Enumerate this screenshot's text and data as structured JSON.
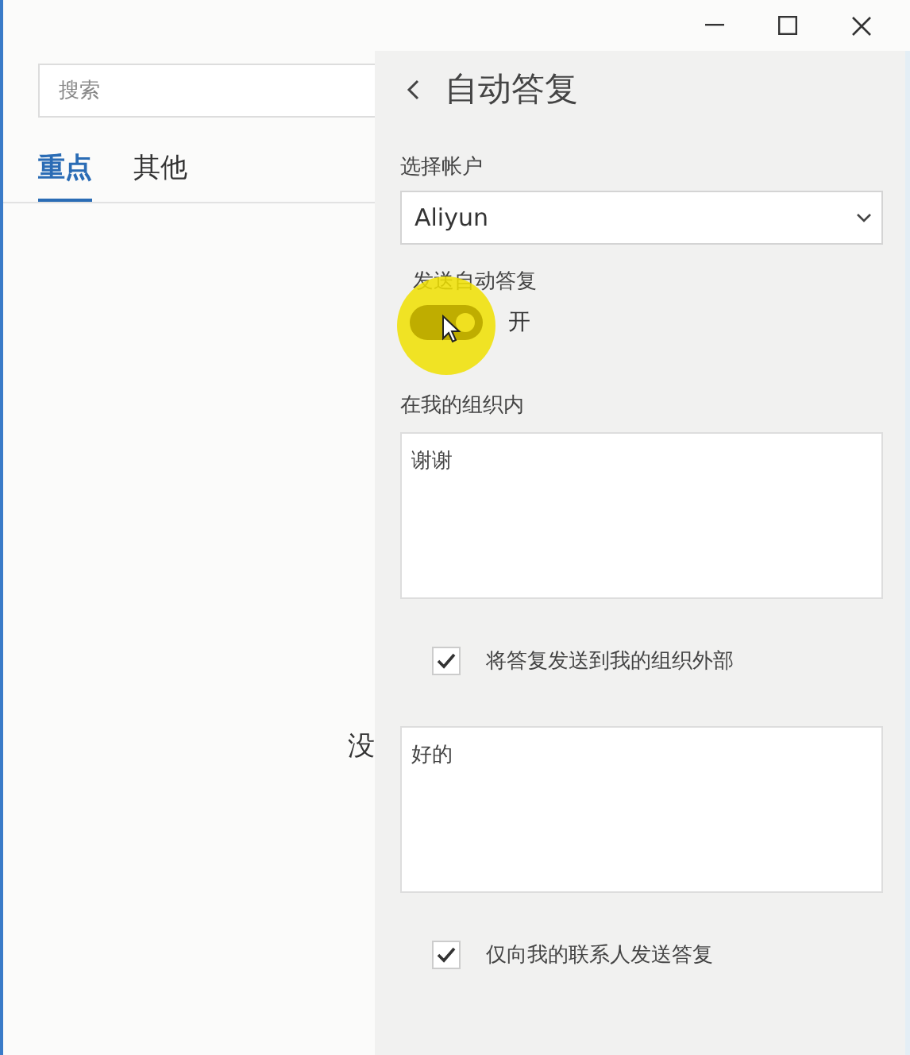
{
  "search": {
    "placeholder": "搜索"
  },
  "tabs": [
    {
      "label": "重点",
      "selected": true
    },
    {
      "label": "其他",
      "selected": false
    }
  ],
  "message_list": {
    "empty_text": "没"
  },
  "auto_reply": {
    "title": "自动答复",
    "account_label": "选择帐户",
    "account": "Aliyun",
    "send_label": "发送自动答复",
    "send_on": true,
    "send_state": "开",
    "inside_label": "在我的组织内",
    "inside_message": "谢谢",
    "outside_option": {
      "label": "将答复发送到我的组织外部",
      "checked": true
    },
    "outside_message": "好的",
    "contacts_option": {
      "label": "仅向我的联系人发送答复",
      "checked": true
    }
  }
}
